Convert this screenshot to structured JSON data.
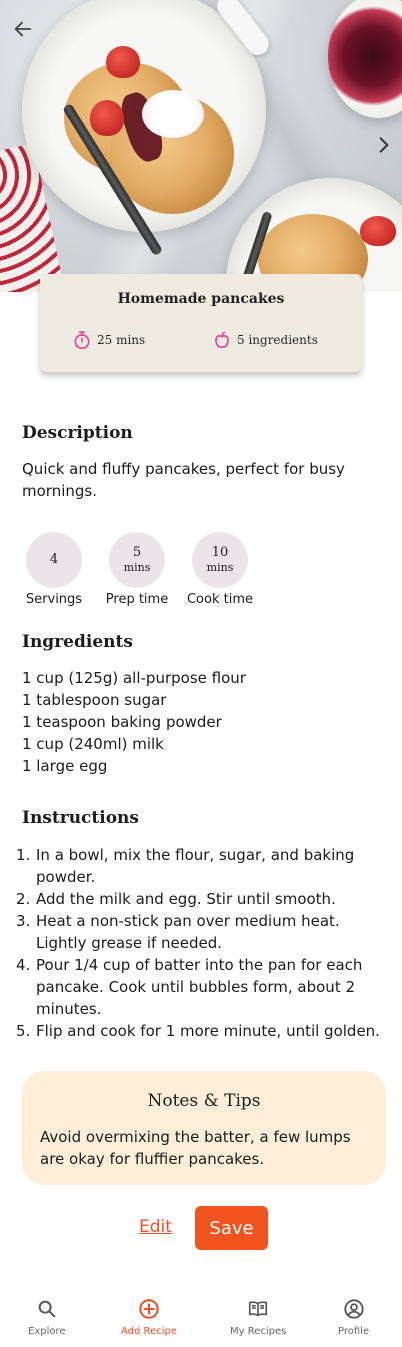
{
  "hero": {
    "image": "pancakes-photo",
    "back_icon": "arrow-left-icon",
    "next_icon": "chevron-right-icon"
  },
  "recipe": {
    "title": "Homemade pancakes",
    "time": "25 mins",
    "ingredients_count": "5 ingredients",
    "time_icon": "stopwatch-icon",
    "ingredients_icon": "apple-icon",
    "accent_color": "#e0449a"
  },
  "description": {
    "heading": "Description",
    "text": "Quick and fluffy pancakes, perfect for busy mornings."
  },
  "stats": [
    {
      "value": "4",
      "unit": "",
      "label": "Servings"
    },
    {
      "value": "5",
      "unit": "mins",
      "label": "Prep time"
    },
    {
      "value": "10",
      "unit": "mins",
      "label": "Cook time"
    }
  ],
  "ingredients": {
    "heading": "Ingredients",
    "items": [
      "1 cup (125g) all-purpose flour",
      "1 tablespoon sugar",
      "1 teaspoon baking powder",
      "1 cup (240ml) milk",
      "1 large egg"
    ]
  },
  "instructions": {
    "heading": "Instructions",
    "steps": [
      {
        "num": "1.",
        "text": "In a bowl, mix the flour, sugar, and baking powder."
      },
      {
        "num": "2.",
        "text": "Add the milk and egg. Stir until smooth."
      },
      {
        "num": "3.",
        "text": "Heat a non-stick pan over medium heat. Lightly grease if needed."
      },
      {
        "num": "4.",
        "text": "Pour 1/4 cup of batter into the pan for each pancake. Cook until bubbles form, about 2 minutes."
      },
      {
        "num": "5.",
        "text": "Flip and cook for 1 more minute, until golden."
      }
    ]
  },
  "notes": {
    "title": "Notes & Tips",
    "text": "Avoid overmixing the batter, a few lumps are okay for fluffier pancakes."
  },
  "actions": {
    "edit_label": "Edit",
    "save_label": "Save",
    "primary_color": "#f2541f"
  },
  "nav": {
    "items": [
      {
        "label": "Explore",
        "icon": "search-icon",
        "active": false
      },
      {
        "label": "Add Recipe",
        "icon": "plus-circle-icon",
        "active": true
      },
      {
        "label": "My Recipes",
        "icon": "book-icon",
        "active": false
      },
      {
        "label": "Profile",
        "icon": "user-circle-icon",
        "active": false
      }
    ]
  }
}
